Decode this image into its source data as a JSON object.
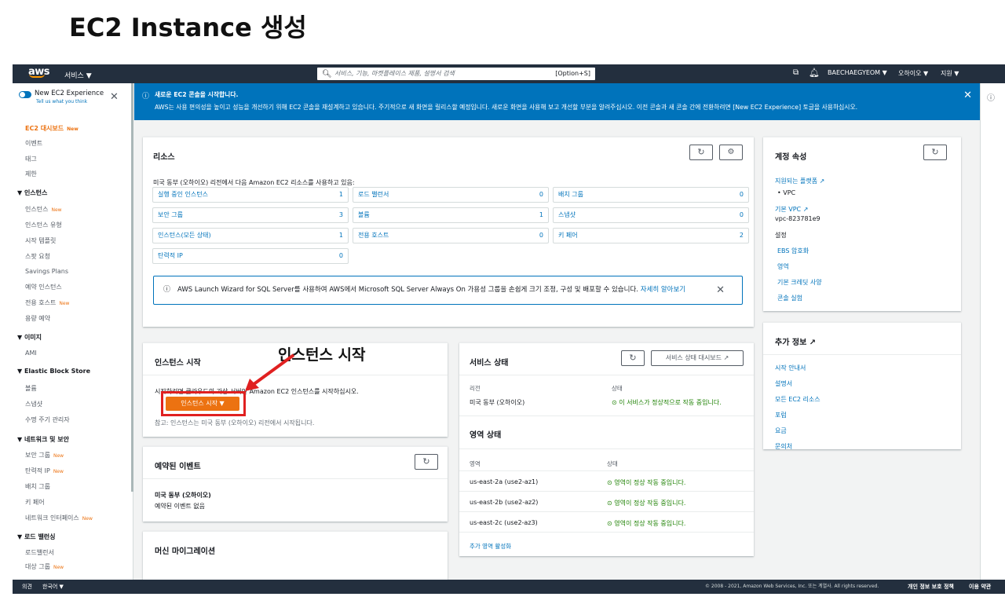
{
  "page_title": "EC2 Instance 생성",
  "topnav": {
    "logo": "aws",
    "services": "서비스 ▼",
    "search_placeholder": "서비스, 기능, 마켓플레이스 제품, 설명서 검색",
    "search_shortcut": "[Option+S]",
    "user": "BAECHAEGYEOM ▼",
    "region": "오하이오 ▼",
    "support": "지원 ▼"
  },
  "leftnav": {
    "experience_title": "New EC2 Experience",
    "experience_sub": "Tell us what you think",
    "new_badge": "New",
    "items": [
      {
        "label": "EC2 대시보드",
        "type": "active",
        "new": true
      },
      {
        "label": "이벤트",
        "type": "item"
      },
      {
        "label": "태그",
        "type": "item"
      },
      {
        "label": "제한",
        "type": "item"
      },
      {
        "label": "▼ 인스턴스",
        "type": "head"
      },
      {
        "label": "인스턴스",
        "type": "item",
        "new": true
      },
      {
        "label": "인스턴스 유형",
        "type": "item"
      },
      {
        "label": "시작 템플릿",
        "type": "item"
      },
      {
        "label": "스팟 요청",
        "type": "item"
      },
      {
        "label": "Savings Plans",
        "type": "item"
      },
      {
        "label": "예약 인스턴스",
        "type": "item"
      },
      {
        "label": "전용 호스트",
        "type": "item",
        "new": true
      },
      {
        "label": "용량 예약",
        "type": "item"
      },
      {
        "label": "▼ 이미지",
        "type": "head"
      },
      {
        "label": "AMI",
        "type": "item"
      },
      {
        "label": "▼ Elastic Block Store",
        "type": "head"
      },
      {
        "label": "볼륨",
        "type": "item"
      },
      {
        "label": "스냅샷",
        "type": "item"
      },
      {
        "label": "수명 주기 관리자",
        "type": "item"
      },
      {
        "label": "▼ 네트워크 및 보안",
        "type": "head"
      },
      {
        "label": "보안 그룹",
        "type": "item",
        "new": true
      },
      {
        "label": "탄력적 IP",
        "type": "item",
        "new": true
      },
      {
        "label": "배치 그룹",
        "type": "item"
      },
      {
        "label": "키 페어",
        "type": "item"
      },
      {
        "label": "네트워크 인터페이스",
        "type": "item",
        "new": true
      },
      {
        "label": "▼ 로드 밸런싱",
        "type": "head"
      },
      {
        "label": "로드밸런서",
        "type": "item"
      },
      {
        "label": "대상 그룹",
        "type": "item",
        "new": true
      }
    ]
  },
  "banner": {
    "title": "새로운 EC2 콘솔을 시작합니다.",
    "text": "AWS는 사용 편의성을 높이고 성능을 개선하기 위해 EC2 콘솔을 재설계하고 있습니다. 주기적으로 새 화면을 릴리스할 예정입니다. 새로운 화면을 사용해 보고 개선할 부분을 알려주십시오. 이전 콘솔과 새 콘솔 간에 전환하려면 [New EC2 Experience] 토글을 사용하십시오."
  },
  "resources": {
    "title": "리소스",
    "intro": "미국 동부 (오하이오) 리전에서 다음 Amazon EC2 리소스를 사용하고 있음:",
    "cells": [
      {
        "label": "실행 중인 인스턴스",
        "value": "1"
      },
      {
        "label": "로드 밸런서",
        "value": "0"
      },
      {
        "label": "배치 그룹",
        "value": "0"
      },
      {
        "label": "보안 그룹",
        "value": "3"
      },
      {
        "label": "볼륨",
        "value": "1"
      },
      {
        "label": "스냅샷",
        "value": "0"
      },
      {
        "label": "인스턴스(모든 상태)",
        "value": "1"
      },
      {
        "label": "전용 호스트",
        "value": "0"
      },
      {
        "label": "키 페어",
        "value": "2"
      },
      {
        "label": "탄력적 IP",
        "value": "0"
      }
    ],
    "sql_text": "AWS Launch Wizard for SQL Server를 사용하여 AWS에서 Microsoft SQL Server Always On 가용성 그룹을 손쉽게 크기 조정, 구성 및 배포할 수 있습니다.",
    "sql_link": "자세히 알아보기"
  },
  "account": {
    "title": "계정 속성",
    "platforms_link": "지원되는 플랫폼 ↗",
    "platform_item": "• VPC",
    "default_vpc_link": "기본 VPC ↗",
    "vpc_id": "vpc-823781e9",
    "settings_label": "설정",
    "settings_links": [
      "EBS 암호화",
      "영역",
      "기본 크레딧 사양",
      "콘솔 실험"
    ]
  },
  "more_info": {
    "title": "추가 정보 ↗",
    "links": [
      "시작 안내서",
      "설명서",
      "모든 EC2 리소스",
      "포럼",
      "요금",
      "문의처"
    ]
  },
  "launch": {
    "title": "인스턴스 시작",
    "text": "시작하려면 클라우드의 가상 서버인 Amazon EC2 인스턴스를 시작하십시오.",
    "button": "인스턴스 시작 ▼",
    "note": "참고: 인스턴스는 미국 동부 (오하이오) 리전에서 시작됩니다.",
    "annotation": "인스턴스 시작"
  },
  "events": {
    "title": "예약된 이벤트",
    "region": "미국 동부 (오하이오)",
    "none": "예약된 이벤트 없음"
  },
  "migration": {
    "title": "머신 마이그레이션"
  },
  "service_health": {
    "title": "서비스 상태",
    "dashboard_button": "서비스 상태 대시보드 ↗",
    "region_label": "리전",
    "region_value": "미국 동부 (오하이오)",
    "status_label": "상태",
    "status_value": "⊙ 이 서비스가 정상적으로 작동 중입니다."
  },
  "zone_status": {
    "title": "영역 상태",
    "col_zone": "영역",
    "col_status": "상태",
    "rows": [
      {
        "zone": "us-east-2a (use2-az1)",
        "status": "⊙ 영역이 정상 작동 중입니다."
      },
      {
        "zone": "us-east-2b (use2-az2)",
        "status": "⊙ 영역이 정상 작동 중입니다."
      },
      {
        "zone": "us-east-2c (use2-az3)",
        "status": "⊙ 영역이 정상 작동 중입니다."
      }
    ],
    "enable_link": "추가 영역 활성화"
  },
  "footer": {
    "feedback": "의견",
    "language": "한국어 ▼",
    "copyright": "© 2008 - 2021, Amazon Web Services, Inc. 또는 계열사. All rights reserved.",
    "privacy": "개인 정보 보호 정책",
    "terms": "이용 약관"
  },
  "colors": {
    "accent": "#ec7211",
    "link": "#0073bb",
    "nav": "#232f3e",
    "ok": "#1d8102",
    "annotation": "#e02020"
  }
}
